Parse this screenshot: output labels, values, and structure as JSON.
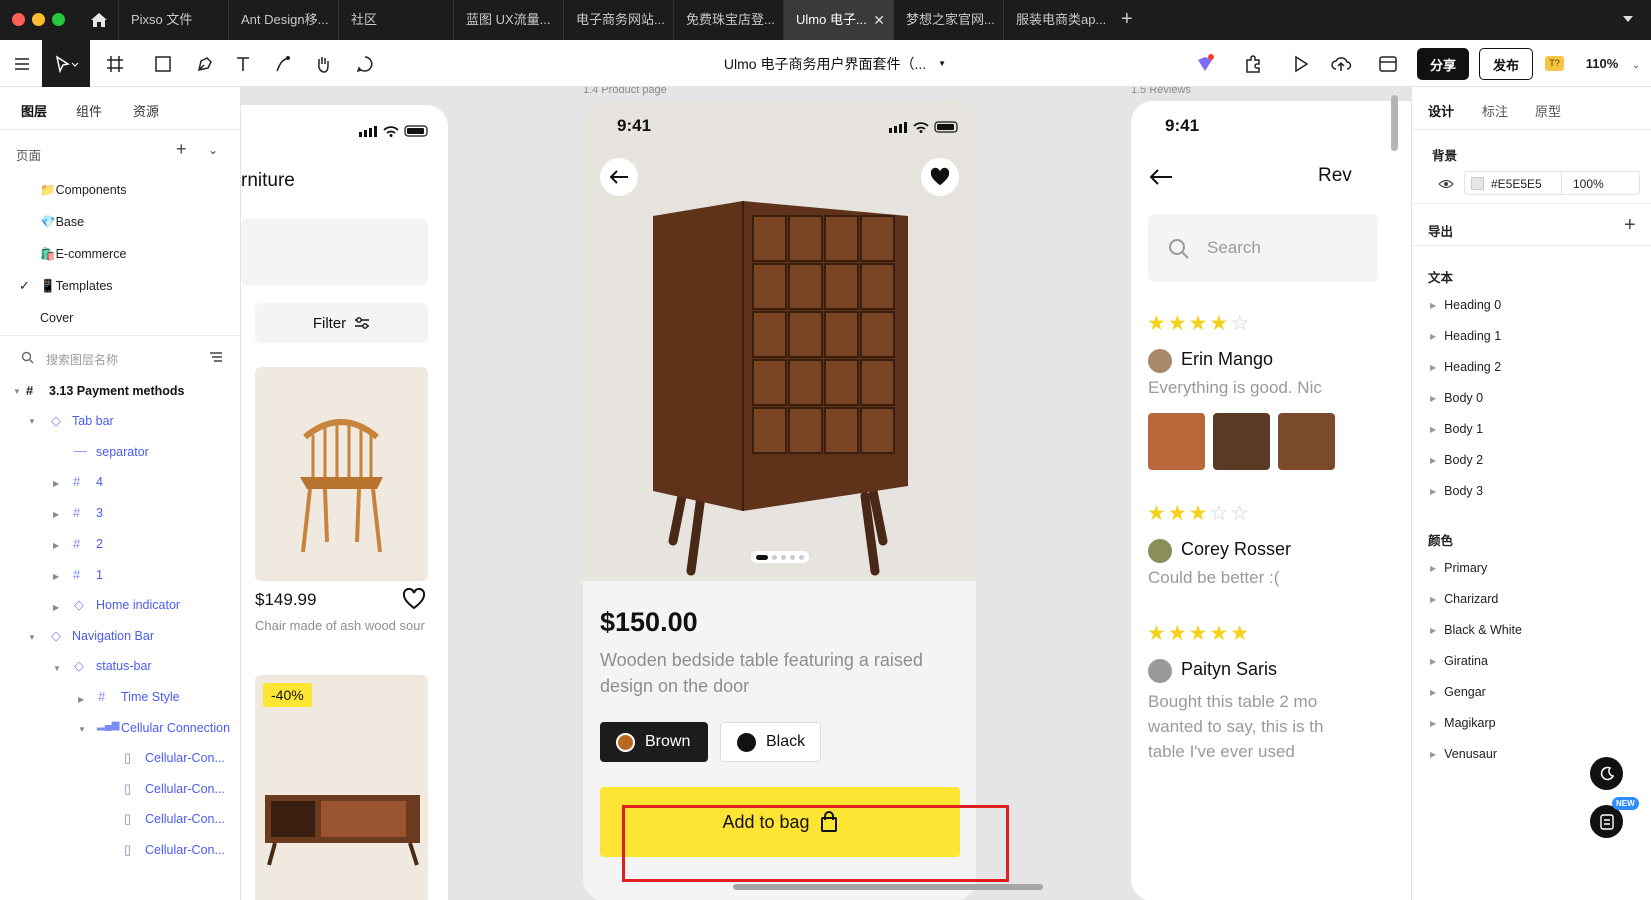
{
  "browser_tabs": [
    {
      "label": "Pixso 文件",
      "active": false
    },
    {
      "label": "Ant Design移...",
      "active": false
    },
    {
      "label": "社区",
      "active": false
    },
    {
      "label": "蓝图 UX流量...",
      "active": false
    },
    {
      "label": "电子商务网站...",
      "active": false
    },
    {
      "label": "免费珠宝店登...",
      "active": false
    },
    {
      "label": "Ulmo 电子...",
      "active": true
    },
    {
      "label": "梦想之家官网...",
      "active": false
    },
    {
      "label": "服装电商类ap...",
      "active": false
    }
  ],
  "toolbar": {
    "doc_title": "Ulmo 电子商务用户界面套件（...",
    "share_label": "分享",
    "publish_label": "发布",
    "zoom": "110%",
    "badge": "T?"
  },
  "left_panel": {
    "tabs": [
      "图层",
      "组件",
      "资源"
    ],
    "pages_label": "页面",
    "pages": [
      "📁Components",
      "💎Base",
      "🛍️E-commerce",
      "📱Templates",
      "Cover"
    ],
    "search_placeholder": "搜索图层名称",
    "layers": [
      {
        "label": "3.13 Payment methods"
      },
      {
        "label": "Tab bar"
      },
      {
        "label": "separator"
      },
      {
        "label": "4"
      },
      {
        "label": "3"
      },
      {
        "label": "2"
      },
      {
        "label": "1"
      },
      {
        "label": "Home indicator"
      },
      {
        "label": "Navigation Bar"
      },
      {
        "label": "status-bar"
      },
      {
        "label": "Time Style"
      },
      {
        "label": "Cellular Connection"
      },
      {
        "label": "Cellular-Con..."
      },
      {
        "label": "Cellular-Con..."
      },
      {
        "label": "Cellular-Con..."
      },
      {
        "label": "Cellular-Con..."
      }
    ]
  },
  "canvas": {
    "catalog": {
      "title_partial": "rniture",
      "filter_label": "Filter",
      "price": "$149.99",
      "desc": "Chair made of ash wood sourced from responsib...",
      "discount": "-40%"
    },
    "product": {
      "frame_label": "1.4 Product page",
      "time": "9:41",
      "price": "$150.00",
      "desc": "Wooden bedside table featuring a raised design on the door",
      "color_brown": "Brown",
      "color_black": "Black",
      "add_label": "Add to bag"
    },
    "reviews": {
      "frame_label": "1.5 Reviews",
      "time": "9:41",
      "title_partial": "Rev",
      "search_placeholder": "Search",
      "items": [
        {
          "name": "Erin Mango",
          "text": "Everything is good. Nic",
          "stars": 4
        },
        {
          "name": "Corey Rosser",
          "text": "Could be better :(",
          "stars": 3
        },
        {
          "name": "Paityn Saris",
          "text": "Bought this table 2 mo wanted to say, this is th table I've ever used",
          "stars": 5
        }
      ]
    }
  },
  "right_panel": {
    "tabs": [
      "设计",
      "标注",
      "原型"
    ],
    "bg_label": "背景",
    "bg_hex": "#E5E5E5",
    "bg_opacity": "100%",
    "export_label": "导出",
    "text_label": "文本",
    "text_styles": [
      "Heading 0",
      "Heading 1",
      "Heading 2",
      "Body 0",
      "Body 1",
      "Body 2",
      "Body 3"
    ],
    "color_label": "颜色",
    "colors": [
      "Primary",
      "Charizard",
      "Black & White",
      "Giratina",
      "Gengar",
      "Magikarp",
      "Venusaur"
    ],
    "new_badge": "NEW"
  },
  "colors": {
    "accent_yellow": "#ffe533",
    "brand_blue": "#4a5cf0",
    "dark": "#1c1c1c"
  }
}
